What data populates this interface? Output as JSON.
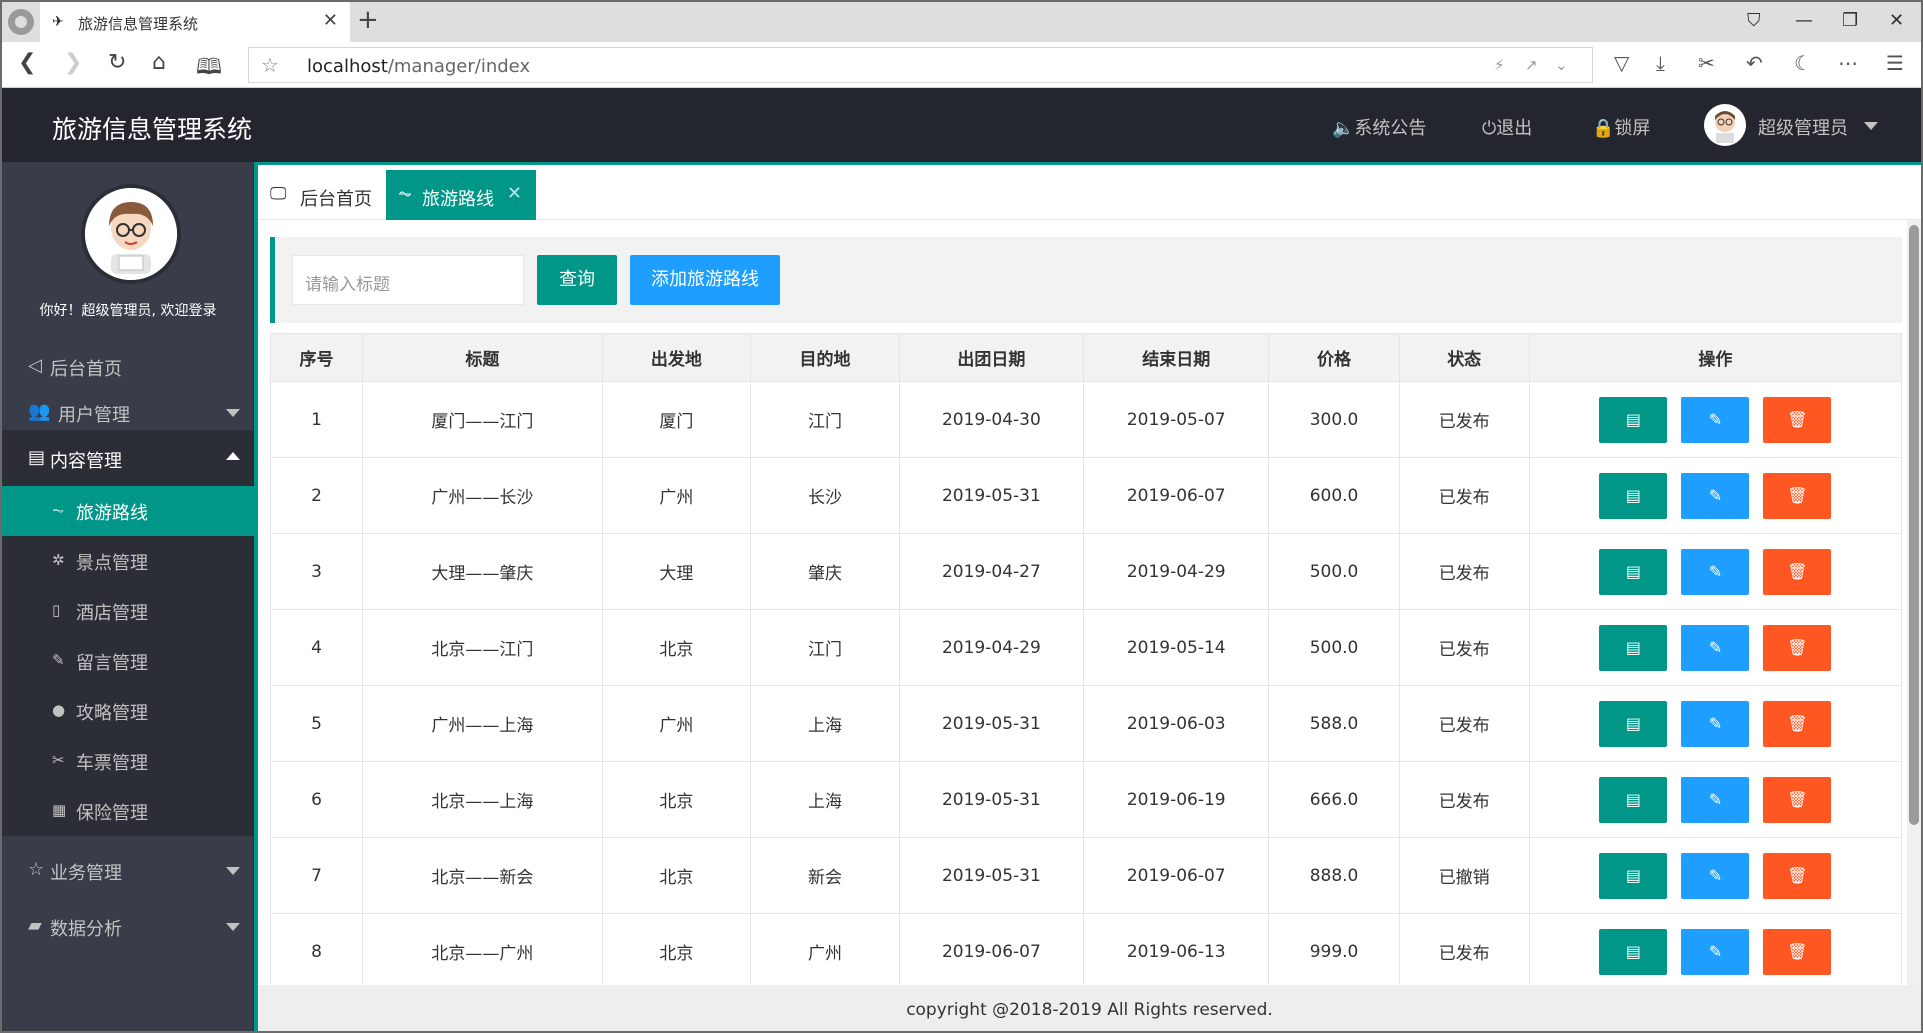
{
  "browser": {
    "tab_title": "旅游信息管理系统",
    "url_host": "localhost",
    "url_path": "/manager/index"
  },
  "header": {
    "app_title": "旅游信息管理系统",
    "announcement": "系统公告",
    "logout": "退出",
    "lock": "锁屏",
    "user": "超级管理员"
  },
  "sidebar": {
    "welcome": "你好！超级管理员, 欢迎登录",
    "items": [
      {
        "label": "后台首页",
        "icon": "send-icon"
      },
      {
        "label": "用户管理",
        "icon": "users-icon"
      },
      {
        "label": "内容管理",
        "icon": "image-icon"
      },
      {
        "label": "业务管理",
        "icon": "star-icon"
      },
      {
        "label": "数据分析",
        "icon": "chart-icon"
      }
    ],
    "subitems": [
      {
        "label": "旅游路线",
        "icon": "pulse-icon"
      },
      {
        "label": "景点管理",
        "icon": "palm-icon"
      },
      {
        "label": "酒店管理",
        "icon": "note-icon"
      },
      {
        "label": "留言管理",
        "icon": "pen-icon"
      },
      {
        "label": "攻略管理",
        "icon": "circle-icon"
      },
      {
        "label": "车票管理",
        "icon": "scissors-icon"
      },
      {
        "label": "保险管理",
        "icon": "calendar-icon"
      }
    ]
  },
  "tabs": [
    {
      "label": "后台首页"
    },
    {
      "label": "旅游路线"
    }
  ],
  "search": {
    "placeholder": "请输入标题",
    "query_label": "查询",
    "add_label": "添加旅游路线"
  },
  "table": {
    "headers": [
      "序号",
      "标题",
      "出发地",
      "目的地",
      "出团日期",
      "结束日期",
      "价格",
      "状态",
      "操作"
    ],
    "rows": [
      [
        "1",
        "厦门——江门",
        "厦门",
        "江门",
        "2019-04-30",
        "2019-05-07",
        "300.0",
        "已发布"
      ],
      [
        "2",
        "广州——长沙",
        "广州",
        "长沙",
        "2019-05-31",
        "2019-06-07",
        "600.0",
        "已发布"
      ],
      [
        "3",
        "大理——肇庆",
        "大理",
        "肇庆",
        "2019-04-27",
        "2019-04-29",
        "500.0",
        "已发布"
      ],
      [
        "4",
        "北京——江门",
        "北京",
        "江门",
        "2019-04-29",
        "2019-05-14",
        "500.0",
        "已发布"
      ],
      [
        "5",
        "广州——上海",
        "广州",
        "上海",
        "2019-05-31",
        "2019-06-03",
        "588.0",
        "已发布"
      ],
      [
        "6",
        "北京——上海",
        "北京",
        "上海",
        "2019-05-31",
        "2019-06-19",
        "666.0",
        "已发布"
      ],
      [
        "7",
        "北京——新会",
        "北京",
        "新会",
        "2019-05-31",
        "2019-06-07",
        "888.0",
        "已撤销"
      ],
      [
        "8",
        "北京——广州",
        "北京",
        "广州",
        "2019-06-07",
        "2019-06-13",
        "999.0",
        "已发布"
      ]
    ]
  },
  "footer": "copyright @2018-2019 All Rights reserved.",
  "colors": {
    "accent": "#009688",
    "blue": "#1e9fff",
    "danger": "#ff5722",
    "dark": "#393d49",
    "header": "#23262e"
  }
}
